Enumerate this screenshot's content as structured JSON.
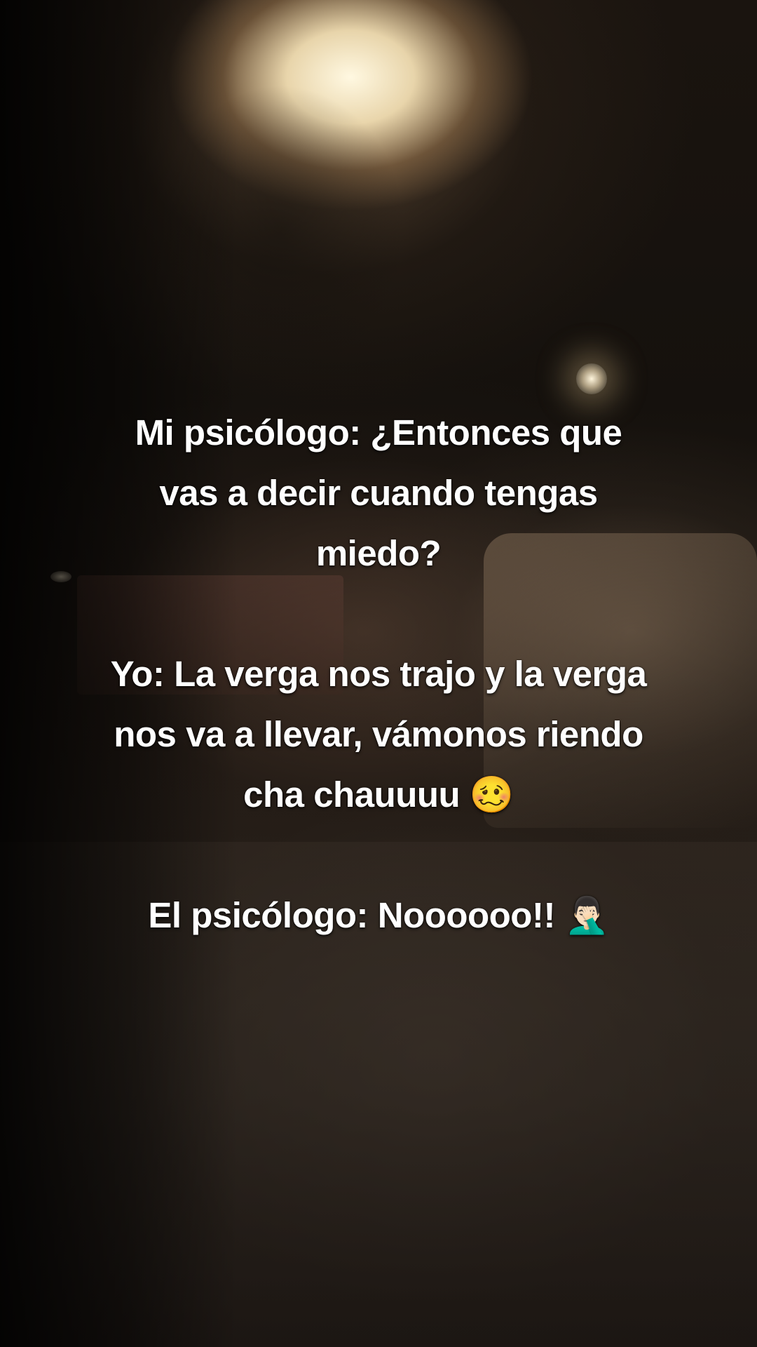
{
  "caption": {
    "line_psychologist": "Mi psicólogo: ¿Entonces que\nvas a decir cuando tengas\nmiedo?",
    "line_me": "Yo: La verga nos trajo y la verga\nnos va a llevar, vámonos riendo\ncha chauuuu 🥴",
    "line_reply": "El psicólogo: Noooooo!! 🤦🏻‍♂️"
  }
}
